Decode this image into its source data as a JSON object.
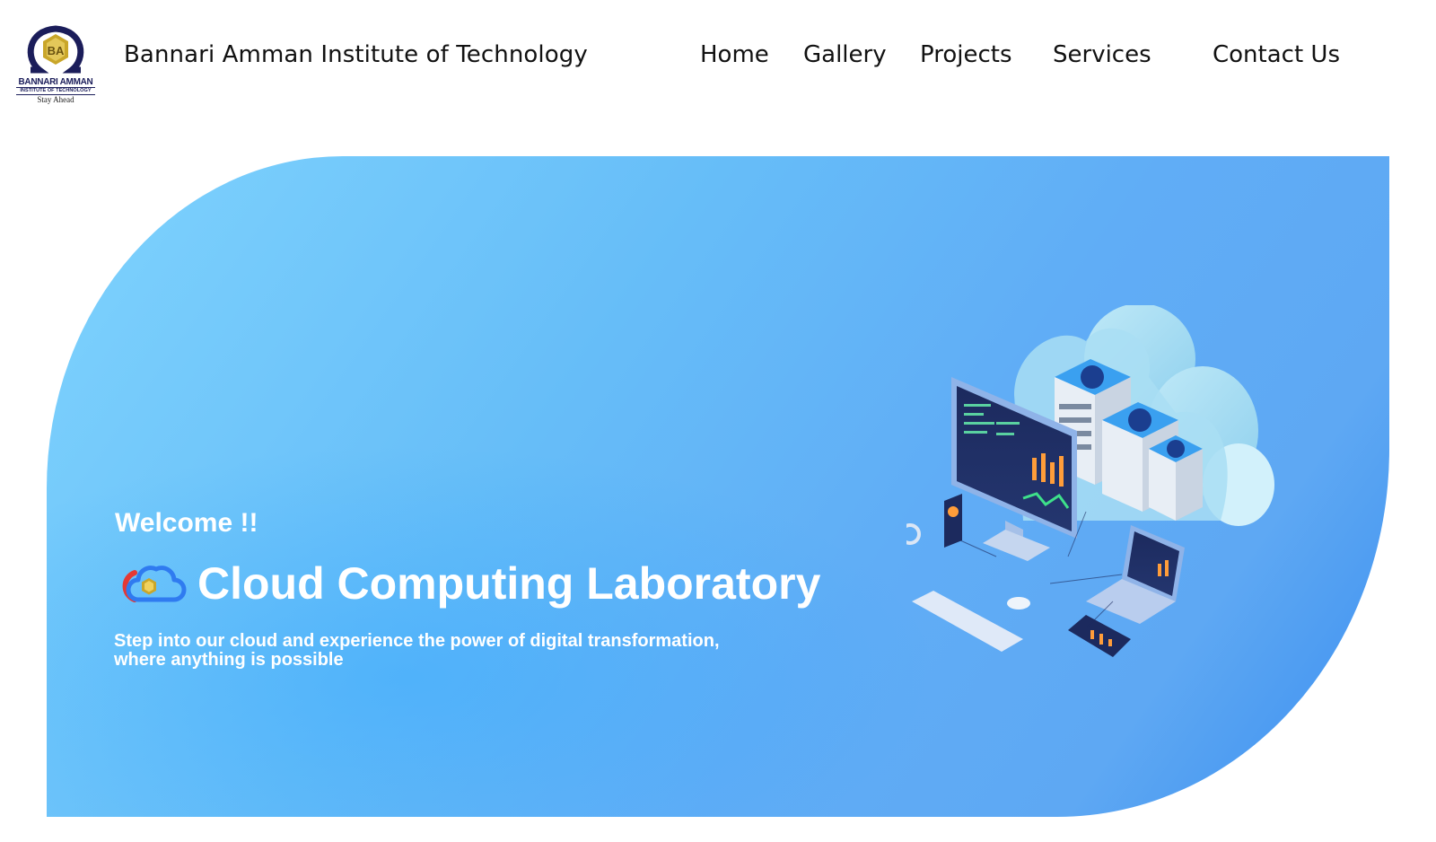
{
  "header": {
    "logo": {
      "line1": "BANNARI AMMAN",
      "line2": "INSTITUTE OF TECHNOLOGY",
      "line3": "Stay Ahead",
      "colors": {
        "ring": "#1b1d5a",
        "emblem": "#c9a62a"
      }
    },
    "site_title": "Bannari Amman Institute of Technology",
    "nav": {
      "home": "Home",
      "gallery": "Gallery",
      "projects": "Projects",
      "services": "Services",
      "contact": "Contact Us"
    }
  },
  "hero": {
    "welcome": "Welcome !!",
    "title": "Cloud Computing Laboratory",
    "subtitle": "Step into our cloud and experience the power of digital transformation, where anything is possible",
    "colors": {
      "gradient_start": "#7fd3fd",
      "gradient_end": "#3a8ef0",
      "text": "#ffffff"
    },
    "illustration": "isometric-cloud-computing-illustration"
  }
}
